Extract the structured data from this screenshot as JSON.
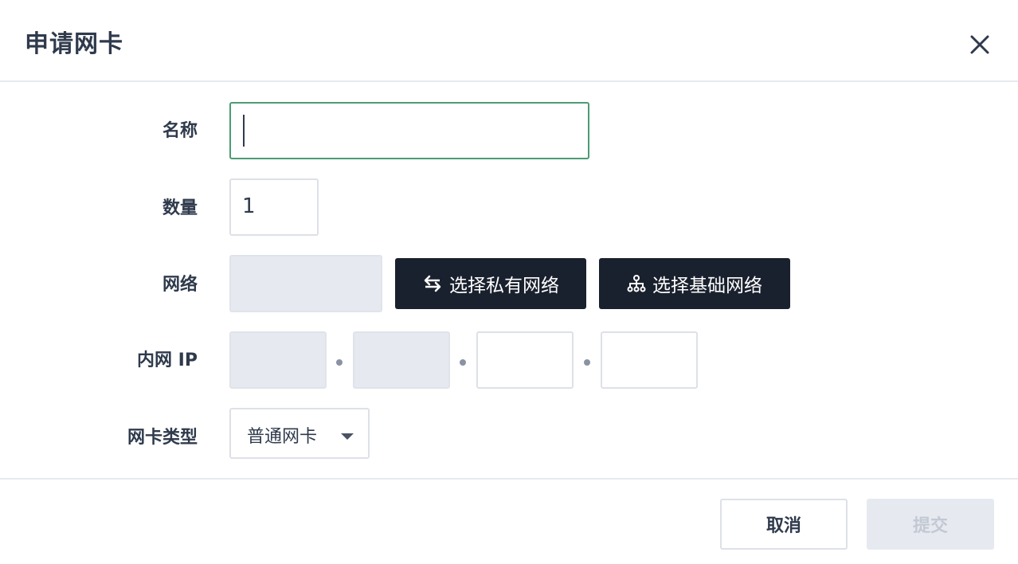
{
  "dialog": {
    "title": "申请网卡",
    "close_icon": "close-icon"
  },
  "form": {
    "name": {
      "label": "名称",
      "value": ""
    },
    "quantity": {
      "label": "数量",
      "value": "1"
    },
    "network": {
      "label": "网络",
      "value": "",
      "private_button": {
        "label": "选择私有网络",
        "icon": "swap-arrows-icon"
      },
      "basic_button": {
        "label": "选择基础网络",
        "icon": "network-tree-icon"
      }
    },
    "internal_ip": {
      "label": "内网 IP",
      "octets": [
        "",
        "",
        "",
        ""
      ]
    },
    "nic_type": {
      "label": "网卡类型",
      "selected": "普通网卡"
    }
  },
  "footer": {
    "cancel_label": "取消",
    "submit_label": "提交"
  },
  "colors": {
    "focus_border": "#4c9b73",
    "dark_button": "#1a212e",
    "disabled_bg": "#e6eaf0",
    "text": "#2f3a4c"
  }
}
